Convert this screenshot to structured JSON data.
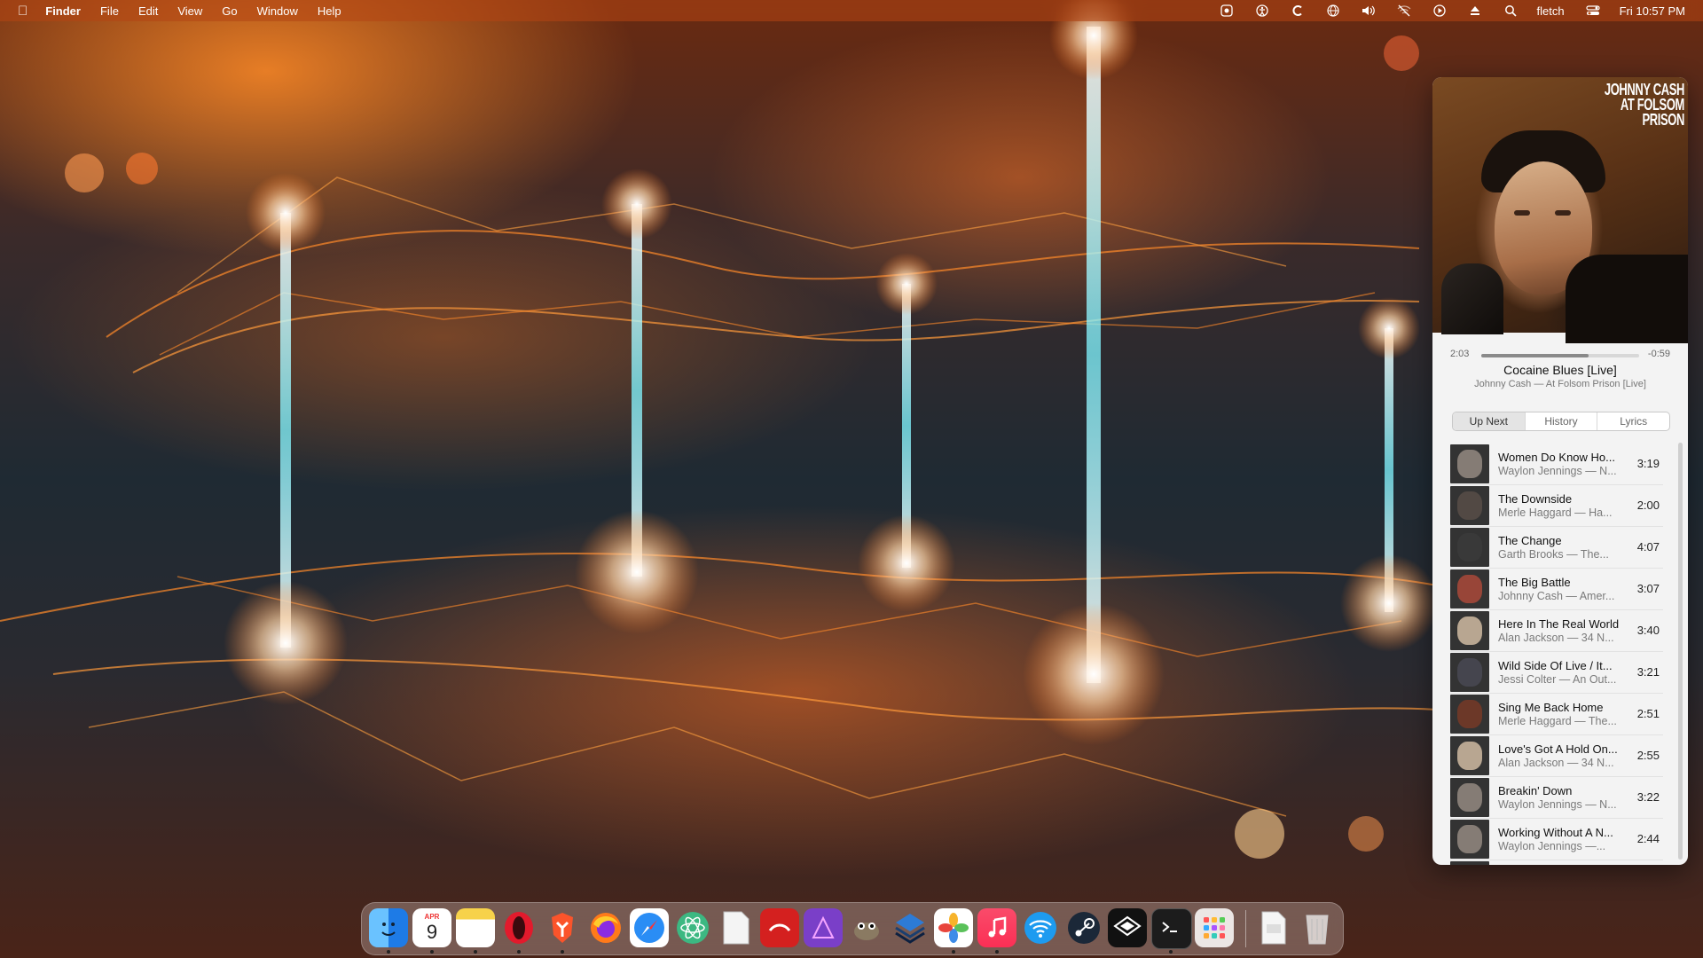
{
  "menubar": {
    "apple": "",
    "app_name": "Finder",
    "menus": [
      "File",
      "Edit",
      "View",
      "Go",
      "Window",
      "Help"
    ],
    "status_icons": [
      "scale-icon",
      "accessibility-icon",
      "c-icon",
      "globe-icon",
      "volume-icon",
      "wifi-off-icon",
      "play-circle-icon",
      "eject-icon",
      "search-icon"
    ],
    "user": "fletch",
    "control_center_icon": "toggle-icon",
    "datetime": "Fri 10:57 PM"
  },
  "player": {
    "album_art_title": "JOHNNY CASH AT FOLSOM PRISON",
    "elapsed": "2:03",
    "remaining": "-0:59",
    "progress_fraction": 0.68,
    "song_title": "Cocaine Blues [Live]",
    "song_subtitle": "Johnny Cash — At Folsom Prison [Live]",
    "tabs": [
      "Up Next",
      "History",
      "Lyrics"
    ],
    "active_tab": "Up Next",
    "queue": [
      {
        "title": "Women Do Know Ho...",
        "subtitle": "Waylon Jennings — N...",
        "duration": "3:19"
      },
      {
        "title": "The Downside",
        "subtitle": "Merle Haggard — Ha...",
        "duration": "2:00"
      },
      {
        "title": "The Change",
        "subtitle": "Garth Brooks — The...",
        "duration": "4:07"
      },
      {
        "title": "The Big Battle",
        "subtitle": "Johnny Cash — Amer...",
        "duration": "3:07"
      },
      {
        "title": "Here In The Real World",
        "subtitle": "Alan Jackson — 34 N...",
        "duration": "3:40"
      },
      {
        "title": "Wild Side Of Live / It...",
        "subtitle": "Jessi Colter — An Out...",
        "duration": "3:21"
      },
      {
        "title": "Sing Me Back Home",
        "subtitle": "Merle Haggard — The...",
        "duration": "2:51"
      },
      {
        "title": "Love's Got A Hold On...",
        "subtitle": "Alan Jackson — 34 N...",
        "duration": "2:55"
      },
      {
        "title": "Breakin' Down",
        "subtitle": "Waylon Jennings — N...",
        "duration": "3:22"
      },
      {
        "title": "Working Without A N...",
        "subtitle": "Waylon Jennings —...",
        "duration": "2:44"
      },
      {
        "title": "Feelin'",
        "subtitle": "",
        "duration": ""
      }
    ]
  },
  "dock": {
    "calendar_month": "APR",
    "calendar_day": "9",
    "apps": [
      "finder-icon",
      "calendar-icon",
      "notes-icon",
      "opera-icon",
      "brave-icon",
      "firefox-icon",
      "safari-icon",
      "atom-icon",
      "textedit-icon",
      "pdf-reader-icon",
      "affinity-icon",
      "gimp-icon",
      "pages-stack-icon",
      "photos-icon",
      "music-icon",
      "network-icon",
      "steam-icon",
      "airport-icon",
      "terminal-icon",
      "launchpad-icon",
      "pdf-document-icon",
      "trash-icon"
    ]
  }
}
